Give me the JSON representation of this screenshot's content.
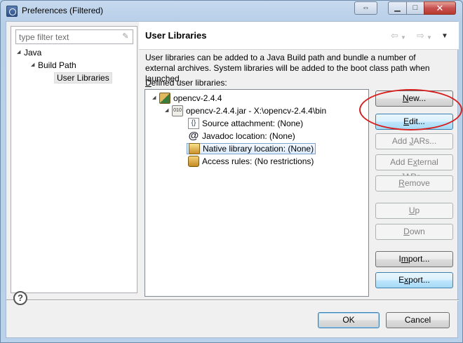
{
  "window": {
    "title": "Preferences (Filtered)",
    "controls": {
      "swap": "⇔",
      "minimize": "▁",
      "maximize": "□",
      "close": "✕"
    }
  },
  "sidebar": {
    "filter_placeholder": "type filter text",
    "tree": [
      {
        "label": "Java",
        "expanded": true
      },
      {
        "label": "Build Path",
        "expanded": true
      },
      {
        "label": "User Libraries",
        "selected": true
      }
    ]
  },
  "page": {
    "title": "User Libraries",
    "nav_back_icon": "back-arrow-icon",
    "nav_forward_icon": "forward-arrow-icon",
    "description": "User libraries can be added to a Java Build path and bundle a number of external archives. System libraries will be added to the boot class path when launched.",
    "defined_label_prefix": "D",
    "defined_label_rest": "efined user libraries:"
  },
  "library_tree": [
    {
      "label": "opencv-2.4.4",
      "icon": "library-icon"
    },
    {
      "label": "opencv-2.4.4.jar - X:\\opencv-2.4.4\\bin",
      "icon": "jar-icon"
    },
    {
      "label": "Source attachment: (None)",
      "icon": "source-attachment-icon"
    },
    {
      "label": "Javadoc location: (None)",
      "icon": "javadoc-icon"
    },
    {
      "label": "Native library location: (None)",
      "icon": "native-library-icon",
      "selected": true
    },
    {
      "label": "Access rules: (No restrictions)",
      "icon": "access-rules-icon"
    }
  ],
  "buttons": {
    "new": {
      "mnemonic": "N",
      "rest": "ew..."
    },
    "edit": {
      "mnemonic": "E",
      "rest": "dit..."
    },
    "add_jars": {
      "pre": "Add ",
      "mnemonic": "J",
      "rest": "ARs..."
    },
    "add_external_jars": {
      "pre": "Add E",
      "mnemonic": "x",
      "rest": "ternal JARs..."
    },
    "remove": {
      "mnemonic": "R",
      "rest": "emove"
    },
    "up": {
      "mnemonic": "U",
      "rest": "p"
    },
    "down": {
      "mnemonic": "D",
      "rest": "own"
    },
    "import": {
      "pre": "I",
      "mnemonic": "m",
      "rest": "port..."
    },
    "export": {
      "pre": "E",
      "mnemonic": "x",
      "rest": "port..."
    },
    "ok": "OK",
    "cancel": "Cancel"
  },
  "help_icon_glyph": "?",
  "annotation_color": "#d61f1f"
}
